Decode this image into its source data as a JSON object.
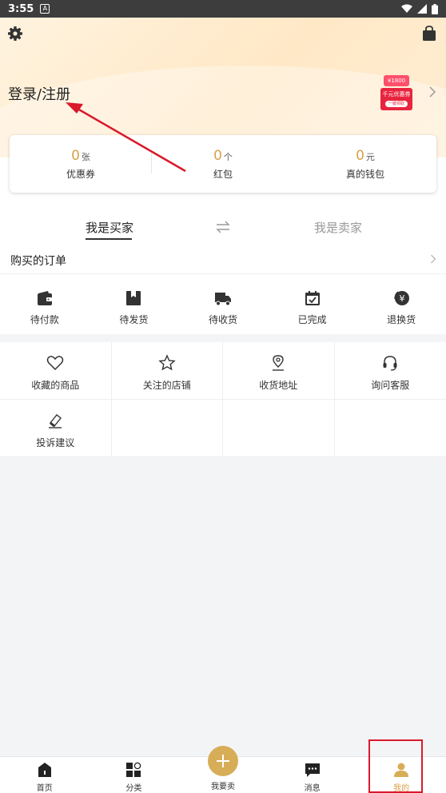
{
  "status_bar": {
    "time": "3:55",
    "notification_glyph": "A"
  },
  "header": {
    "login_label": "登录/注册",
    "promo": {
      "amount": "¥1800",
      "title": "千元优惠券",
      "button": "一键领取"
    }
  },
  "stats": [
    {
      "value": "0",
      "unit": "张",
      "label": "优惠券"
    },
    {
      "value": "0",
      "unit": "个",
      "label": "红包"
    },
    {
      "value": "0",
      "unit": "元",
      "label": "真的钱包"
    }
  ],
  "tabs": {
    "buyer": "我是买家",
    "seller": "我是卖家",
    "active": "buyer"
  },
  "orders": {
    "title": "购买的订单",
    "items": [
      {
        "label": "待付款",
        "icon": "wallet-icon"
      },
      {
        "label": "待发货",
        "icon": "box-icon"
      },
      {
        "label": "待收货",
        "icon": "truck-icon"
      },
      {
        "label": "已完成",
        "icon": "calendar-check-icon"
      },
      {
        "label": "退换货",
        "icon": "yen-refund-icon"
      }
    ]
  },
  "services": [
    {
      "label": "收藏的商品",
      "icon": "heart-icon"
    },
    {
      "label": "关注的店铺",
      "icon": "star-icon"
    },
    {
      "label": "收货地址",
      "icon": "location-pin-icon"
    },
    {
      "label": "询问客服",
      "icon": "headset-icon"
    },
    {
      "label": "投诉建议",
      "icon": "eraser-edit-icon"
    }
  ],
  "bottom_nav": [
    {
      "label": "首页",
      "icon": "home-icon"
    },
    {
      "label": "分类",
      "icon": "category-icon"
    },
    {
      "label": "我要卖",
      "icon": "plus-icon"
    },
    {
      "label": "消息",
      "icon": "chat-icon"
    },
    {
      "label": "我的",
      "icon": "user-icon",
      "active": true
    }
  ],
  "colors": {
    "accent": "#d8a04a",
    "annotation": "#d9192b"
  }
}
